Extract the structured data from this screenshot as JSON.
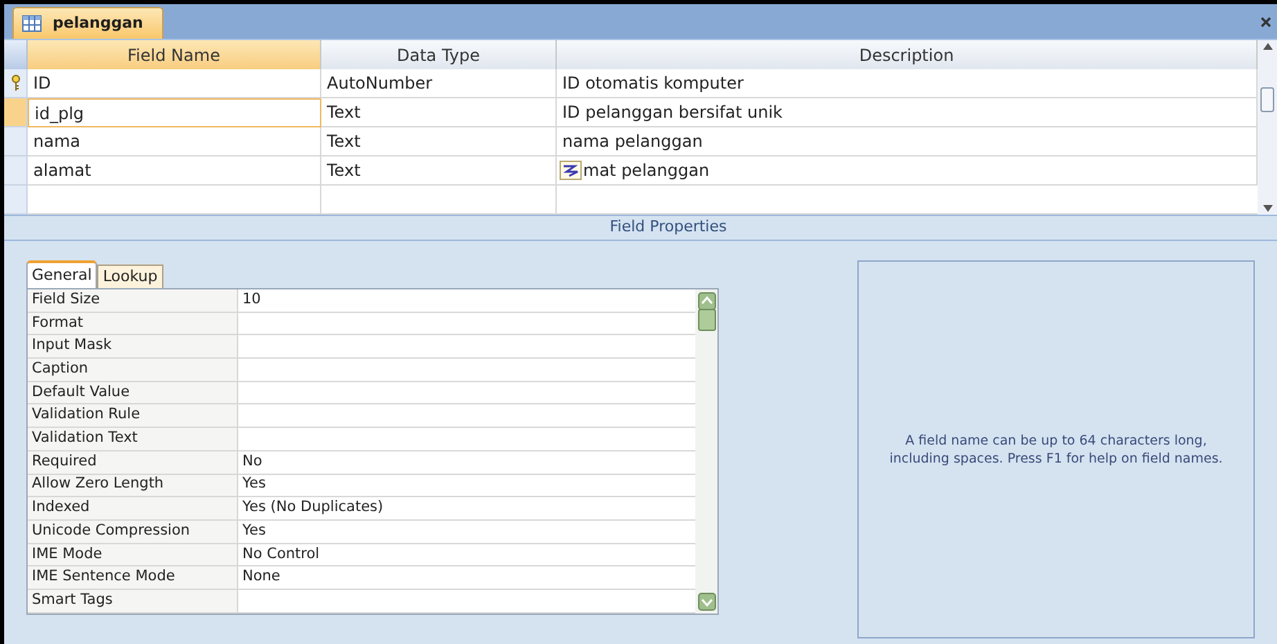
{
  "document_tab": {
    "title": "pelanggan"
  },
  "table": {
    "columns": [
      "Field Name",
      "Data Type",
      "Description"
    ],
    "rows": [
      {
        "field_name": "ID",
        "data_type": "AutoNumber",
        "description": "ID otomatis komputer",
        "primary_key": true,
        "selected": false,
        "smart_tag": false
      },
      {
        "field_name": "id_plg",
        "data_type": "Text",
        "description": "ID pelanggan bersifat unik",
        "primary_key": false,
        "selected": true,
        "smart_tag": false
      },
      {
        "field_name": "nama",
        "data_type": "Text",
        "description": "nama pelanggan",
        "primary_key": false,
        "selected": false,
        "smart_tag": false
      },
      {
        "field_name": "alamat",
        "data_type": "Text",
        "description": "mat pelanggan",
        "primary_key": false,
        "selected": false,
        "smart_tag": true
      }
    ]
  },
  "field_properties": {
    "title": "Field Properties",
    "tabs": [
      {
        "label": "General",
        "selected": true
      },
      {
        "label": "Lookup",
        "selected": false
      }
    ],
    "properties": [
      {
        "name": "Field Size",
        "value": "10"
      },
      {
        "name": "Format"
      },
      {
        "name": "Input Mask"
      },
      {
        "name": "Caption"
      },
      {
        "name": "Default Value"
      },
      {
        "name": "Validation Rule"
      },
      {
        "name": "Validation Text"
      },
      {
        "name": "Required",
        "value": "No"
      },
      {
        "name": "Allow Zero Length",
        "value": "Yes"
      },
      {
        "name": "Indexed",
        "value": "Yes (No Duplicates)"
      },
      {
        "name": "Unicode Compression",
        "value": "Yes"
      },
      {
        "name": "IME Mode",
        "value": "No Control"
      },
      {
        "name": "IME Sentence Mode",
        "value": "None"
      },
      {
        "name": "Smart Tags"
      }
    ],
    "help_text": "A field name can be up to 64 characters long, including spaces.  Press F1 for help on field names."
  }
}
